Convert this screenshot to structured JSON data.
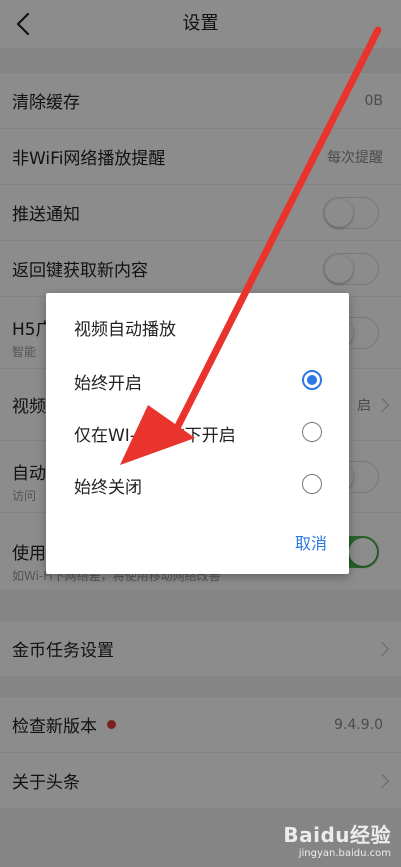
{
  "header": {
    "title": "设置"
  },
  "settings": {
    "clear_cache": {
      "label": "清除缓存",
      "value": "0B"
    },
    "non_wifi_reminder": {
      "label": "非WiFi网络播放提醒",
      "value": "每次提醒"
    },
    "push_notification": {
      "label": "推送通知",
      "enabled": false
    },
    "back_refresh": {
      "label": "返回键获取新内容",
      "enabled": false
    },
    "h5": {
      "label": "H5广",
      "subtitle": "智能",
      "enabled": false
    },
    "video_autoplay": {
      "label": "视频",
      "value": "启"
    },
    "auto": {
      "label": "自动",
      "subtitle": "访问",
      "enabled": false
    },
    "use_mobile": {
      "label": "使用",
      "subtitle": "如Wi-Fi下网络差，将使用移动网络改善",
      "enabled": true
    },
    "coin_tasks": {
      "label": "金币任务设置"
    },
    "check_update": {
      "label": "检查新版本",
      "value": "9.4.9.0"
    },
    "about": {
      "label": "关于头条"
    }
  },
  "dialog": {
    "title": "视频自动播放",
    "options": [
      {
        "label": "始终开启",
        "checked": true
      },
      {
        "label": "仅在WI-FI状态下开启",
        "checked": false
      },
      {
        "label": "始终关闭",
        "checked": false
      }
    ],
    "cancel_label": "取消"
  },
  "annotation": {
    "color": "#e8342c"
  },
  "watermark": {
    "logo": "Baidu经验",
    "url": "jingyan.baidu.com"
  }
}
